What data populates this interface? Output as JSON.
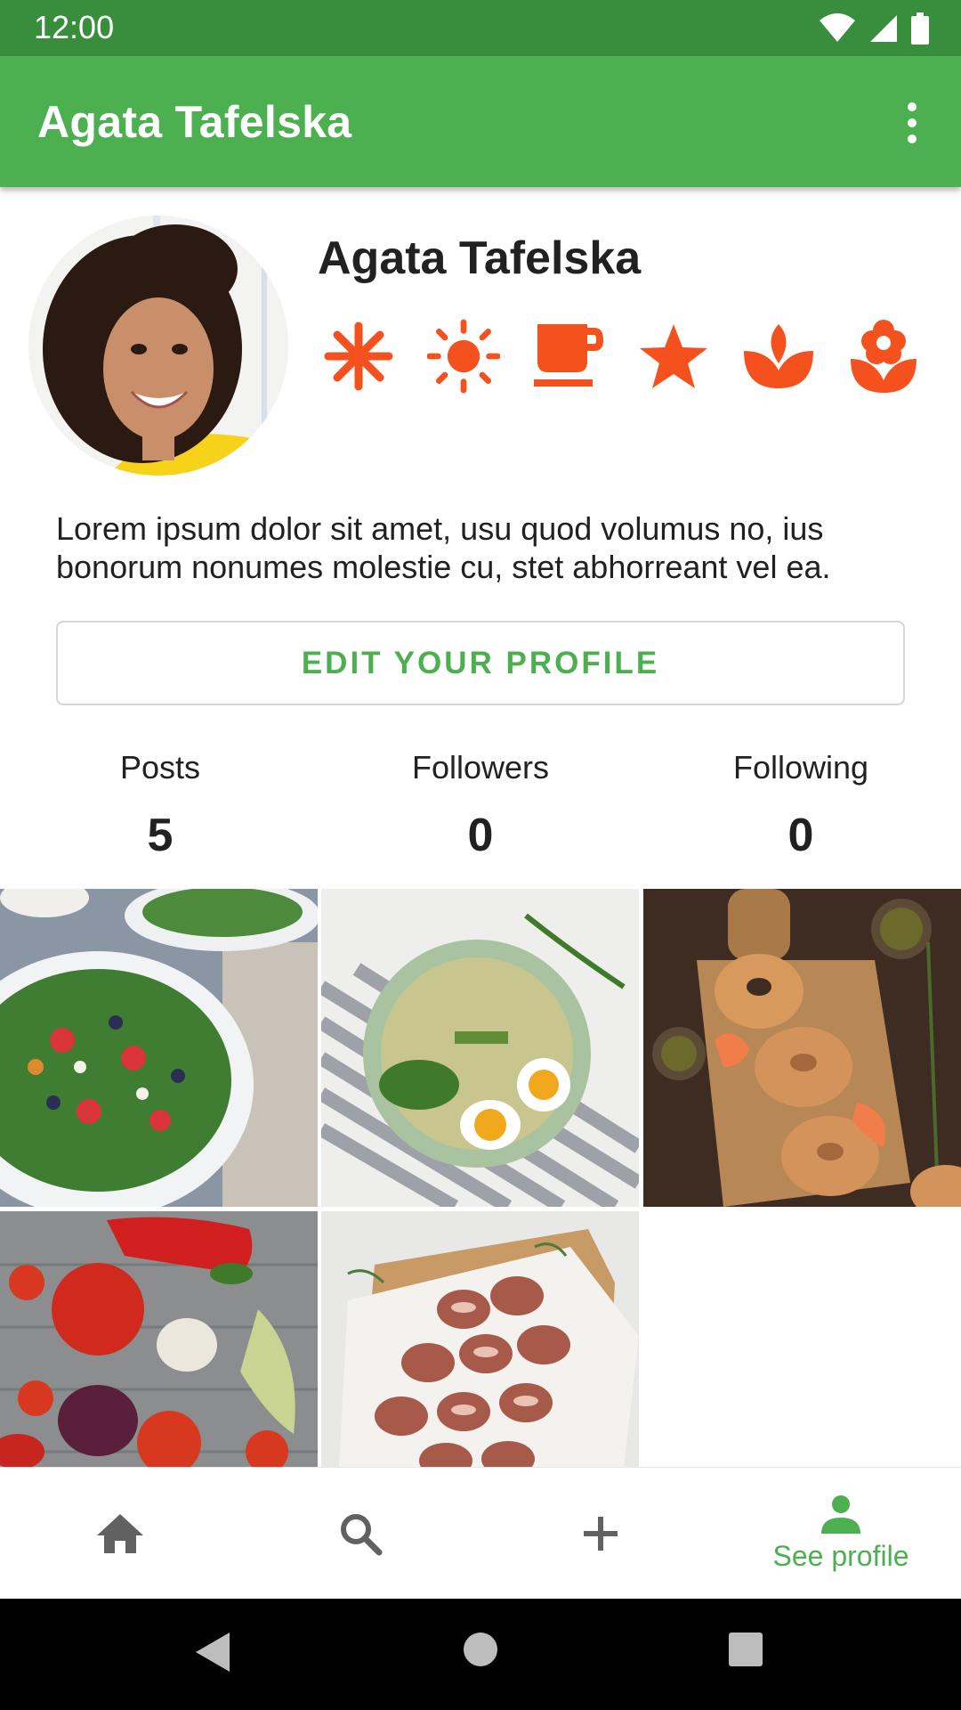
{
  "status_bar": {
    "time": "12:00",
    "icons": [
      "wifi-icon",
      "signal-icon",
      "battery-icon"
    ]
  },
  "app_bar": {
    "title": "Agata Tafelska",
    "menu_icon": "more-vert-icon"
  },
  "profile": {
    "name": "Agata Tafelska",
    "avatar": "woman-portrait-photo",
    "badges": [
      "snowflake-icon",
      "sun-icon",
      "coffee-cup-icon",
      "star-icon",
      "spa-leaf-icon",
      "flower-icon"
    ],
    "bio": "Lorem ipsum dolor sit amet, usu quod volumus no, ius bonorum nonumes molestie cu, stet abhorreant vel ea.",
    "edit_button_label": "EDIT YOUR PROFILE"
  },
  "stats": [
    {
      "label": "Posts",
      "value": "5"
    },
    {
      "label": "Followers",
      "value": "0"
    },
    {
      "label": "Following",
      "value": "0"
    }
  ],
  "photos": [
    "salad-bowl-photo",
    "rice-egg-plate-photo",
    "bagels-salmon-photo",
    "vegetables-photo",
    "bacon-skewers-photo"
  ],
  "bottom_nav": {
    "items": [
      {
        "icon": "home-icon",
        "label": ""
      },
      {
        "icon": "search-icon",
        "label": ""
      },
      {
        "icon": "add-icon",
        "label": ""
      },
      {
        "icon": "person-icon",
        "label": "See profile"
      }
    ],
    "active_index": 3
  },
  "colors": {
    "primary": "#4caf50",
    "primary_dark": "#388e3c",
    "badge_accent": "#f4511e",
    "nav_icon": "#616161"
  }
}
